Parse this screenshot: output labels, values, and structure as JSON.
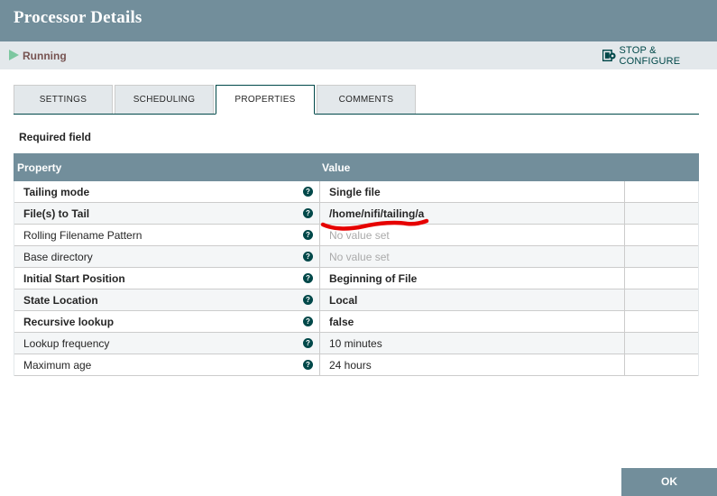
{
  "dialog": {
    "title": "Processor Details",
    "status": "Running",
    "stop_configure_label": "STOP & CONFIGURE"
  },
  "tabs": [
    {
      "label": "SETTINGS",
      "active": false
    },
    {
      "label": "SCHEDULING",
      "active": false
    },
    {
      "label": "PROPERTIES",
      "active": true
    },
    {
      "label": "COMMENTS",
      "active": false
    }
  ],
  "required_field_label": "Required field",
  "table": {
    "headers": {
      "property": "Property",
      "value": "Value"
    },
    "rows": [
      {
        "property": "Tailing mode",
        "value": "Single file",
        "required": true,
        "has_value": true
      },
      {
        "property": "File(s) to Tail",
        "value": "/home/nifi/tailing/a",
        "required": true,
        "has_value": true
      },
      {
        "property": "Rolling Filename Pattern",
        "value": "No value set",
        "required": false,
        "has_value": false
      },
      {
        "property": "Base directory",
        "value": "No value set",
        "required": false,
        "has_value": false
      },
      {
        "property": "Initial Start Position",
        "value": "Beginning of File",
        "required": true,
        "has_value": true
      },
      {
        "property": "State Location",
        "value": "Local",
        "required": true,
        "has_value": true
      },
      {
        "property": "Recursive lookup",
        "value": "false",
        "required": true,
        "has_value": true
      },
      {
        "property": "Lookup frequency",
        "value": "10 minutes",
        "required": false,
        "has_value": true
      },
      {
        "property": "Maximum age",
        "value": "24 hours",
        "required": false,
        "has_value": true
      }
    ]
  },
  "buttons": {
    "ok": "OK"
  },
  "icons": {
    "status": "play-icon",
    "help": "help-icon",
    "stop": "stop-configure-icon"
  },
  "colors": {
    "header": "#728e9b",
    "accent": "#004849",
    "running": "#7dc7a0",
    "annotation": "#e60000"
  }
}
